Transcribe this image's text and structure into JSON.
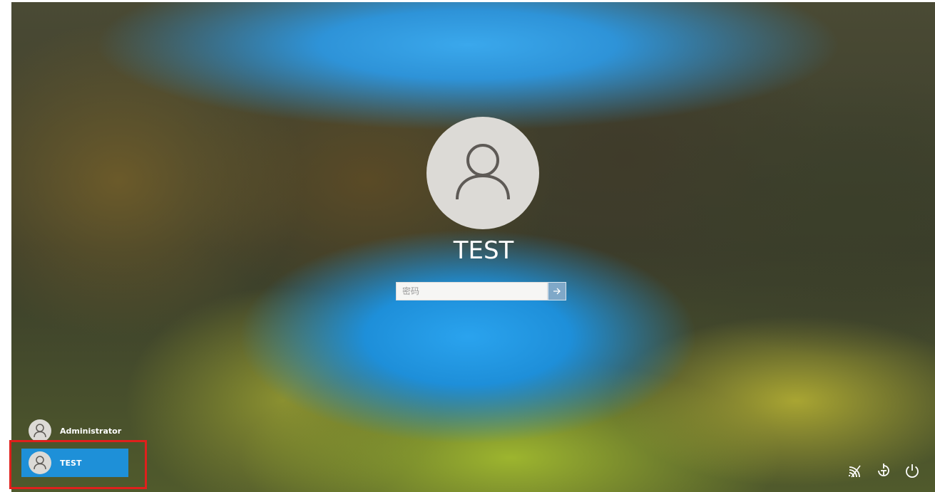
{
  "lock_screen": {
    "current_user": {
      "name": "TEST",
      "avatar_icon": "user-icon"
    },
    "password_field": {
      "placeholder": "密码",
      "value": ""
    },
    "submit_icon": "arrow-right-icon"
  },
  "user_list": [
    {
      "name": "Administrator",
      "icon": "user-icon",
      "selected": false
    },
    {
      "name": "TEST",
      "icon": "user-icon",
      "selected": true
    }
  ],
  "tray": {
    "network_icon": "network-icon",
    "ease_of_access_icon": "ease-of-access-icon",
    "power_icon": "power-icon"
  },
  "colors": {
    "selected_user_bg": "#1e90d8",
    "highlight_border": "#e0201c",
    "submit_button_bg": "#7fa8c8",
    "avatar_bg": "#dcdad6"
  }
}
